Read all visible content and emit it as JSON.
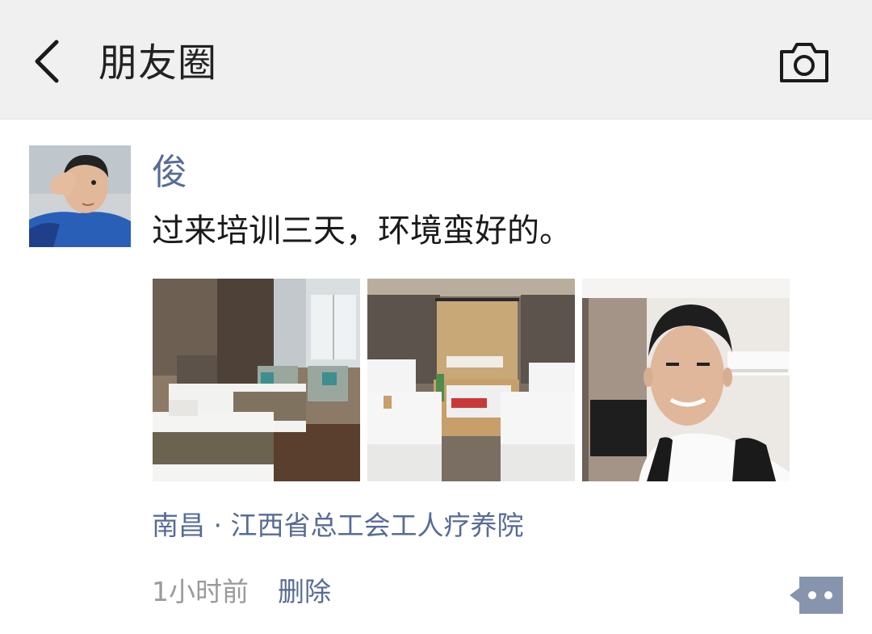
{
  "header": {
    "title": "朋友圈",
    "back_icon": "chevron-left-icon",
    "camera_icon": "camera-icon"
  },
  "post": {
    "username": "俊",
    "text": "过来培训三天，环境蛮好的。",
    "photos": [
      {
        "icon": "hotel-room-photo"
      },
      {
        "icon": "hotel-nightstand-photo"
      },
      {
        "icon": "selfie-photo"
      }
    ],
    "location": "南昌 · 江西省总工会工人疗养院",
    "timestamp": "1小时前",
    "delete_label": "删除",
    "more_icon": "more-dots-icon"
  },
  "colors": {
    "header_bg": "#f0f0f0",
    "link_blue": "#576b95",
    "text_dark": "#1a1a1a",
    "text_gray": "#9a9a9a"
  }
}
